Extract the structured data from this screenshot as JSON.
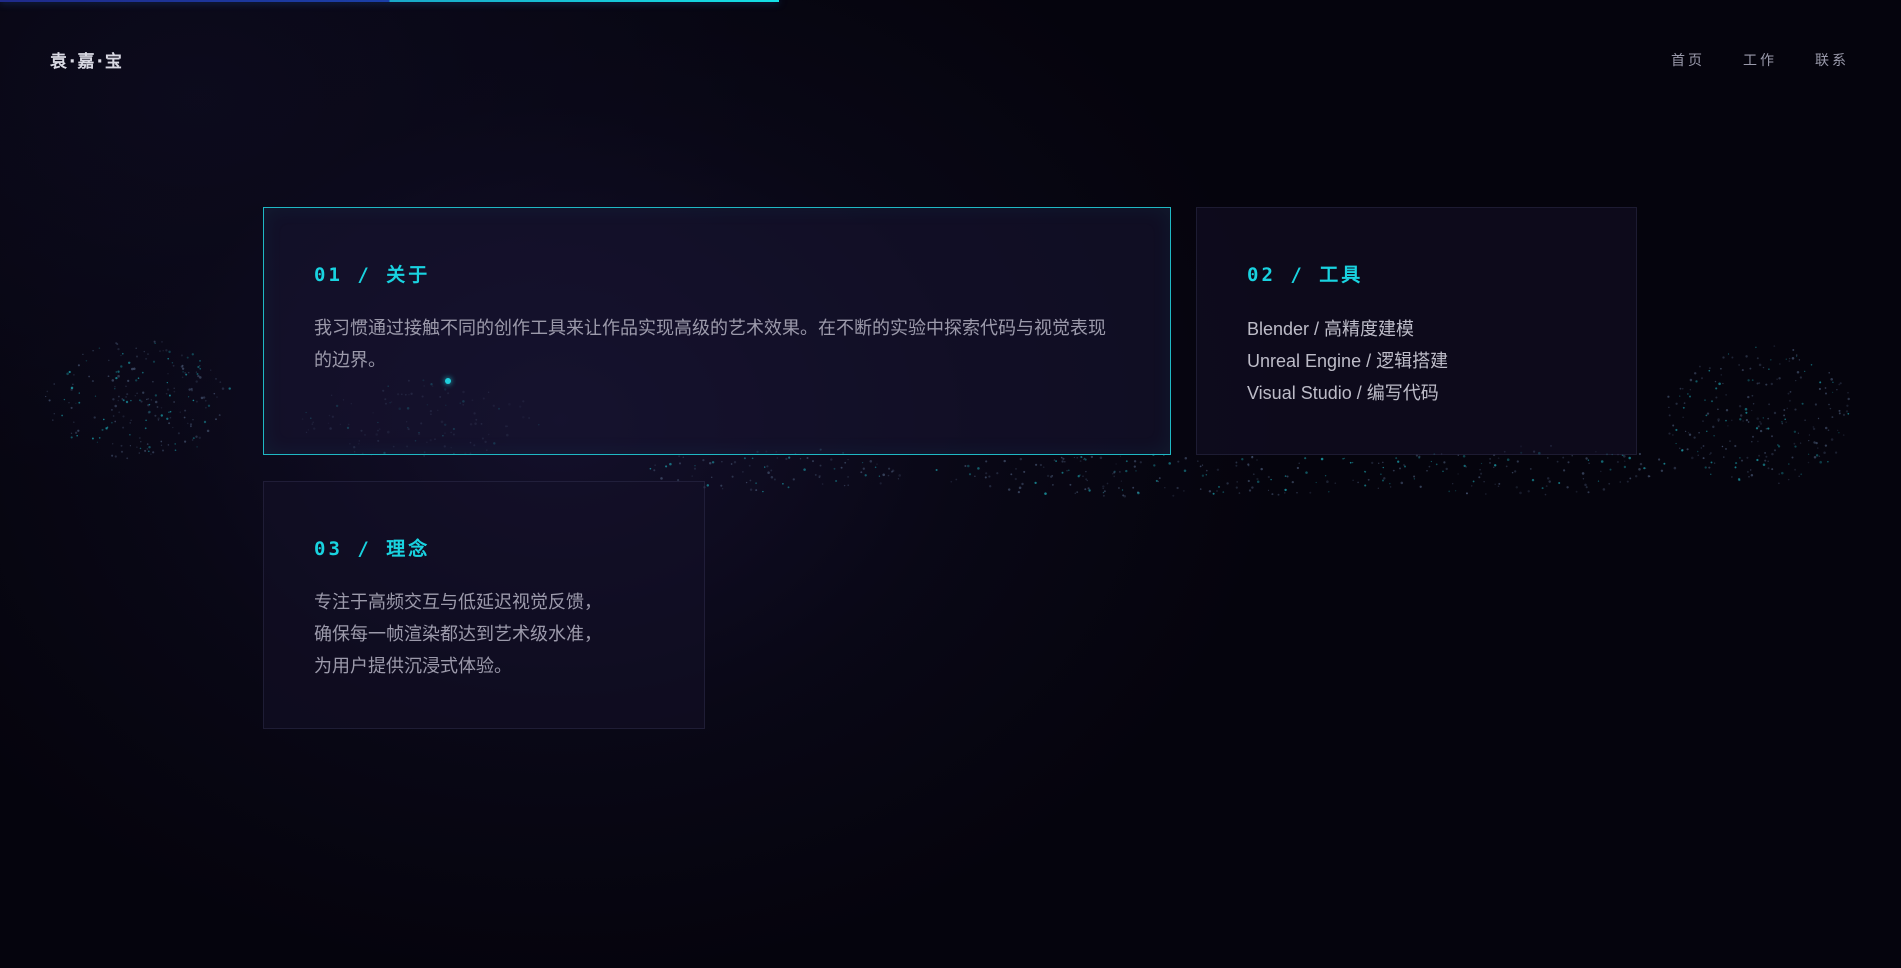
{
  "progress": {
    "value": 0.41
  },
  "header": {
    "logo": "袁·嘉·宝",
    "nav": [
      {
        "label": "首页"
      },
      {
        "label": "工作"
      },
      {
        "label": "联系"
      }
    ]
  },
  "cards": {
    "about": {
      "title": "01 / 关于",
      "text": "我习惯通过接触不同的创作工具来让作品实现高级的艺术效果。在不断的实验中探索代码与视觉表现的边界。"
    },
    "tools": {
      "title": "02 / 工具",
      "items": [
        "Blender / 高精度建模",
        "Unreal Engine / 逻辑搭建",
        "Visual Studio / 编写代码"
      ]
    },
    "philosophy": {
      "title": "03 / 理念",
      "lines": [
        "专注于高频交互与低延迟视觉反馈，",
        "确保每一帧渲染都达到艺术级水准，",
        "为用户提供沉浸式体验。"
      ]
    }
  },
  "colors": {
    "accent": "#19d3e0",
    "background": "#05040d",
    "progress_start": "#1f2a8a",
    "progress_end": "#14e0e6"
  }
}
